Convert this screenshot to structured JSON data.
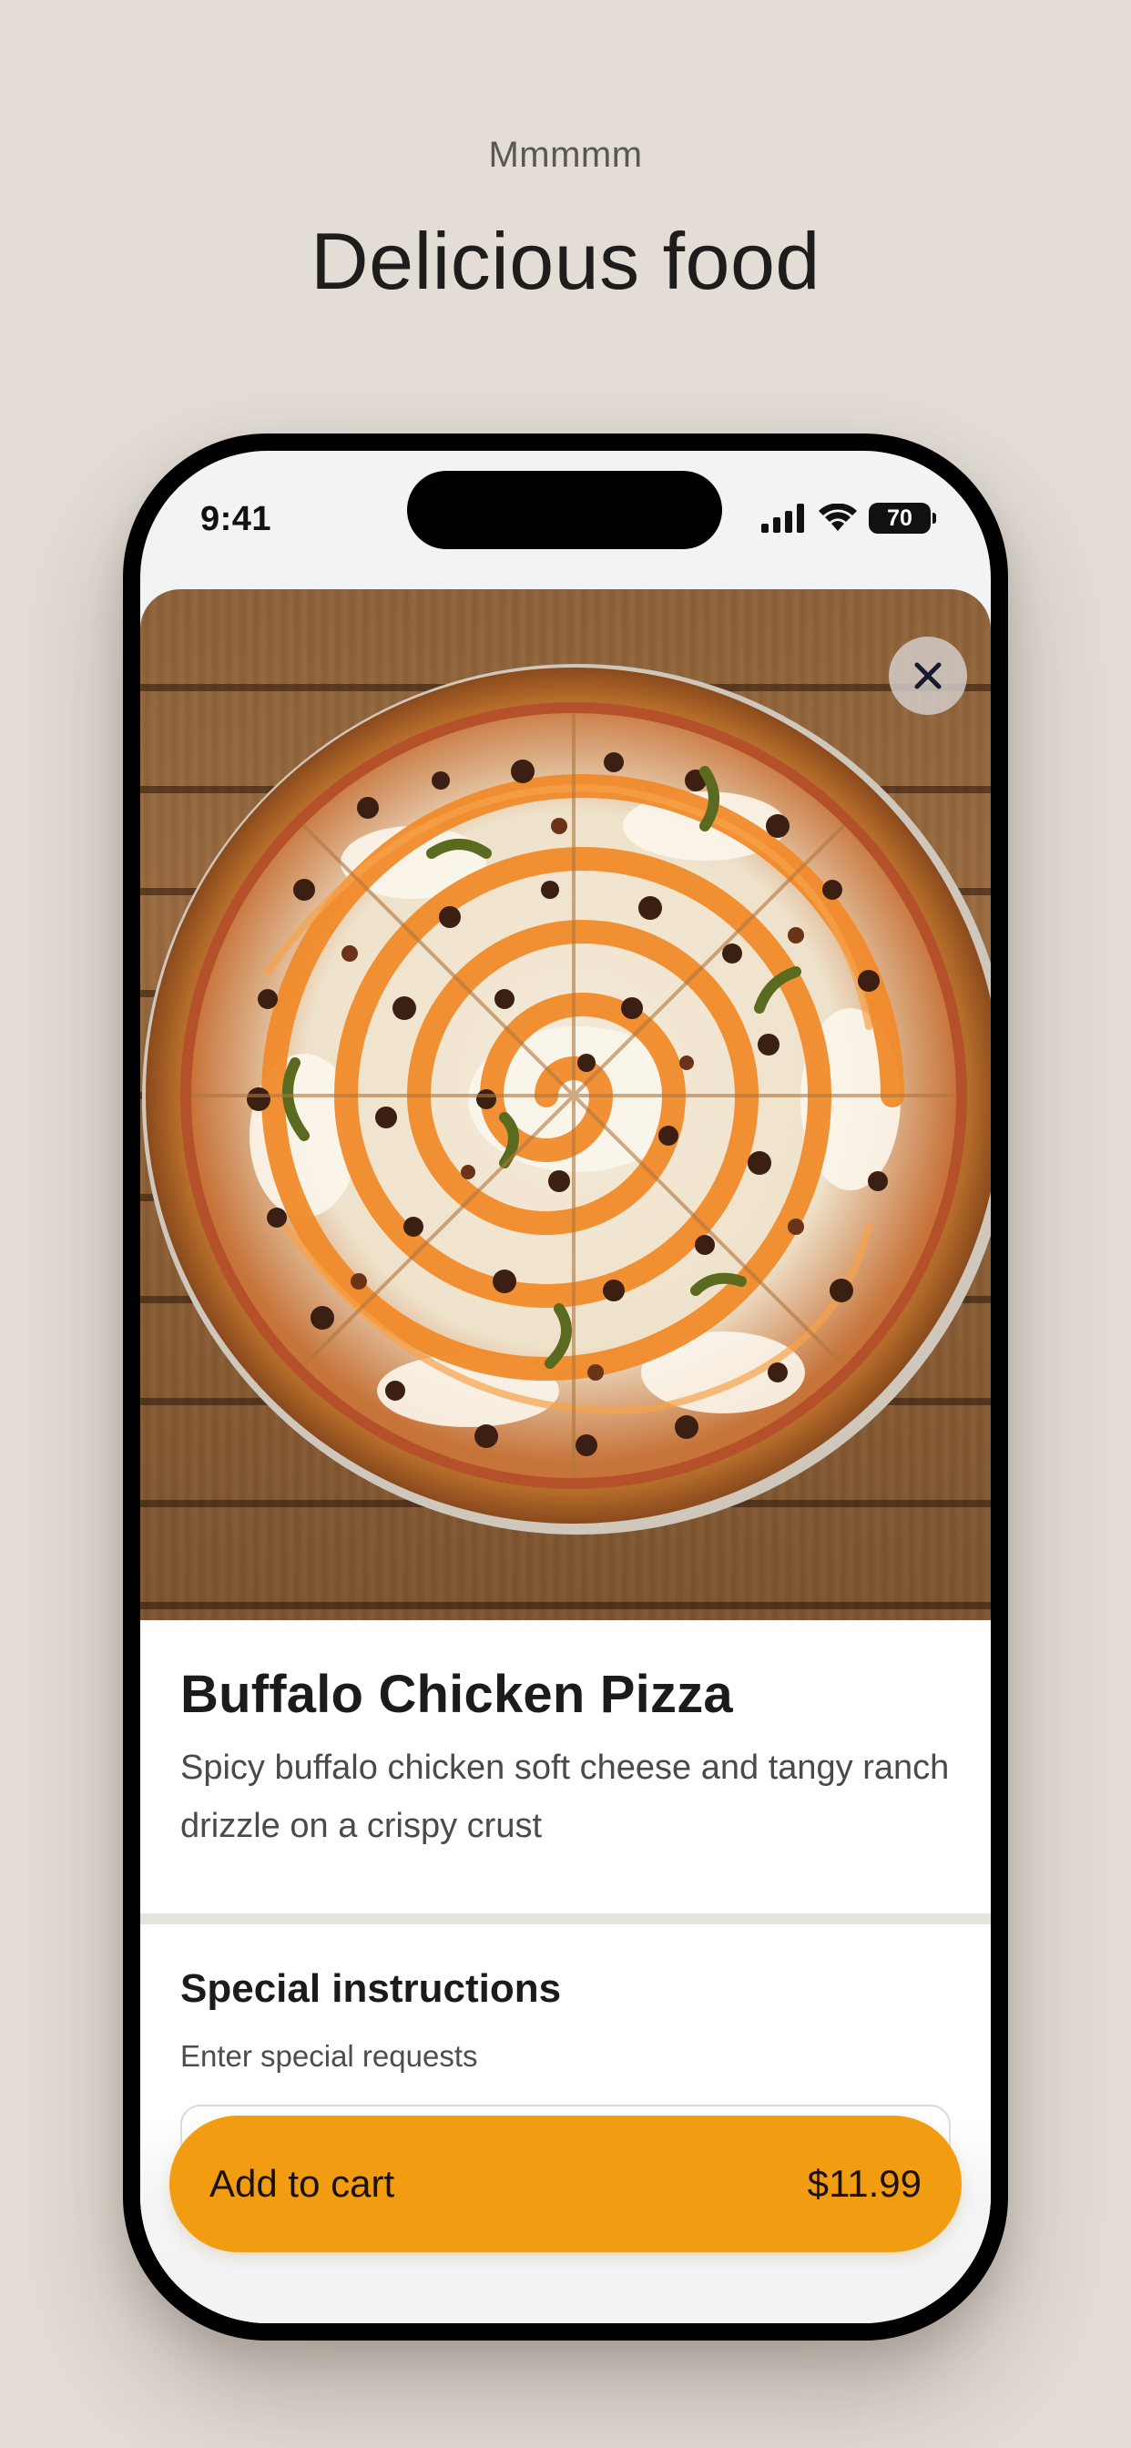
{
  "header": {
    "eyebrow": "Mmmmm",
    "title": "Delicious food"
  },
  "status_bar": {
    "time": "9:41",
    "battery": "70",
    "icons": [
      "signal-icon",
      "wifi-icon",
      "battery-icon"
    ]
  },
  "item": {
    "image_alt": "Buffalo chicken pizza on a wooden table",
    "title": "Buffalo Chicken Pizza",
    "description": "Spicy buffalo chicken soft cheese and tangy ranch drizzle on a crispy crust"
  },
  "special_instructions": {
    "title": "Special instructions",
    "hint": "Enter special requests",
    "value": ""
  },
  "cart": {
    "label": "Add to cart",
    "price": "$11.99"
  },
  "colors": {
    "background": "#e3ddd6",
    "accent": "#f29c12",
    "text": "#1b1b1b"
  }
}
